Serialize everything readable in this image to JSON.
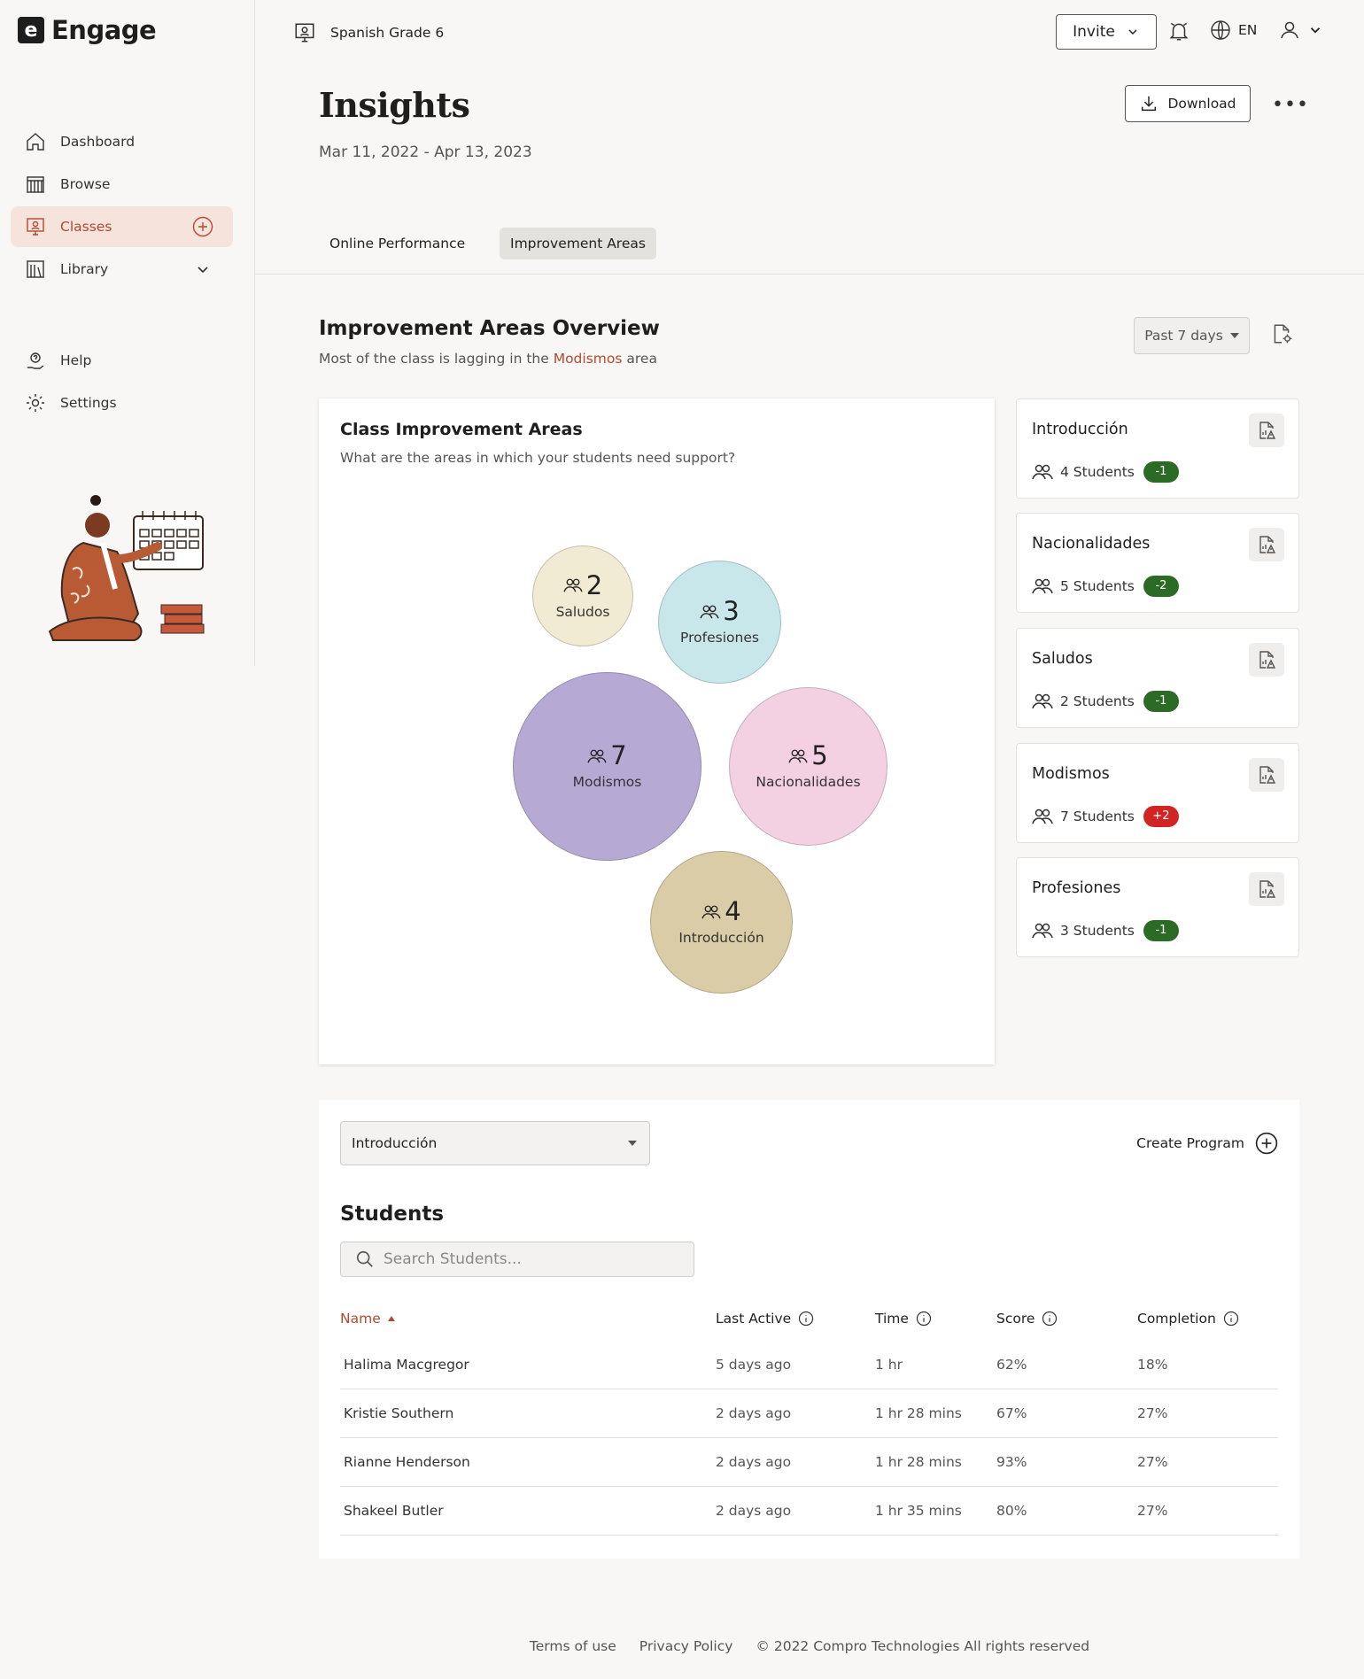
{
  "brand": {
    "mark": "e",
    "name": "Engage"
  },
  "sidebar": {
    "items": [
      {
        "label": "Dashboard",
        "icon": "home-icon"
      },
      {
        "label": "Browse",
        "icon": "browse-icon"
      },
      {
        "label": "Classes",
        "icon": "classes-icon",
        "active": true
      },
      {
        "label": "Library",
        "icon": "library-icon"
      },
      {
        "label": "Help",
        "icon": "help-icon"
      },
      {
        "label": "Settings",
        "icon": "gear-icon"
      }
    ]
  },
  "topbar": {
    "class_name": "Spanish Grade 6",
    "invite_label": "Invite",
    "language": "EN"
  },
  "header": {
    "title": "Insights",
    "date_range": "Mar 11, 2022 - Apr 13, 2023",
    "download_label": "Download"
  },
  "tabs": [
    {
      "label": "Online Performance",
      "active": false
    },
    {
      "label": "Improvement Areas",
      "active": true
    }
  ],
  "overview": {
    "title": "Improvement Areas Overview",
    "subtitle_prefix": "Most of the class is lagging in the",
    "subtitle_highlight": "Modismos",
    "subtitle_suffix": "area",
    "period": "Past 7 days"
  },
  "chart_card": {
    "title": "Class Improvement Areas",
    "subtitle": "What are the areas in which your students need support?"
  },
  "chart_data": {
    "type": "bubble",
    "series": [
      {
        "label": "Saludos",
        "value": 2,
        "color": "#f0ebd2"
      },
      {
        "label": "Profesiones",
        "value": 3,
        "color": "#c8e7ea"
      },
      {
        "label": "Modismos",
        "value": 7,
        "color": "#b6aad4"
      },
      {
        "label": "Nacionalidades",
        "value": 5,
        "color": "#f3d1e3"
      },
      {
        "label": "Introducción",
        "value": 4,
        "color": "#d9cca6"
      }
    ]
  },
  "area_cards": [
    {
      "title": "Introducción",
      "students": "4 Students",
      "change": "-1",
      "trend": "green"
    },
    {
      "title": "Nacionalidades",
      "students": "5 Students",
      "change": "-2",
      "trend": "green"
    },
    {
      "title": "Saludos",
      "students": "2 Students",
      "change": "-1",
      "trend": "green"
    },
    {
      "title": "Modismos",
      "students": "7 Students",
      "change": "+2",
      "trend": "red"
    },
    {
      "title": "Profesiones",
      "students": "3 Students",
      "change": "-1",
      "trend": "green"
    }
  ],
  "students_panel": {
    "selected_area": "Introducción",
    "create_label": "Create Program",
    "title": "Students",
    "search_placeholder": "Search Students...",
    "columns": [
      "Name",
      "Last Active",
      "Time",
      "Score",
      "Completion"
    ],
    "rows": [
      {
        "name": "Halima Macgregor",
        "last_active": "5 days ago",
        "time": "1 hr",
        "score": "62%",
        "completion": "18%"
      },
      {
        "name": "Kristie Southern",
        "last_active": "2 days ago",
        "time": "1 hr 28 mins",
        "score": "67%",
        "completion": "27%"
      },
      {
        "name": "Rianne Henderson",
        "last_active": "2 days ago",
        "time": "1 hr 28 mins",
        "score": "93%",
        "completion": "27%"
      },
      {
        "name": "Shakeel Butler",
        "last_active": "2 days ago",
        "time": "1 hr 35 mins",
        "score": "80%",
        "completion": "27%"
      }
    ]
  },
  "footer": {
    "terms": "Terms of use",
    "privacy": "Privacy Policy",
    "copyright": "© 2022 Compro Technologies All rights reserved"
  }
}
